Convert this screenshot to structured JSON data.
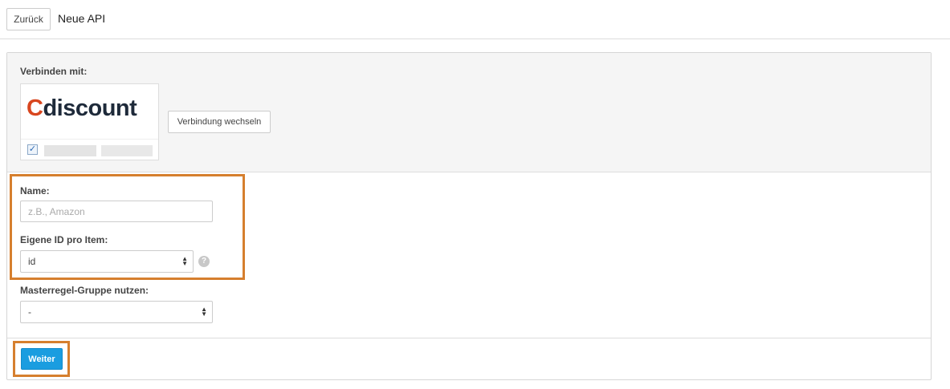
{
  "header": {
    "back_label": "Zurück",
    "title": "Neue API"
  },
  "connection": {
    "label": "Verbinden mit:",
    "logo_text_first": "C",
    "logo_text_rest": "discount",
    "checkbox_checked": true,
    "switch_label": "Verbindung wechseln"
  },
  "form": {
    "name_label": "Name:",
    "name_placeholder": "z.B., Amazon",
    "id_label": "Eigene ID pro Item:",
    "id_value": "id",
    "master_label": "Masterregel-Gruppe nutzen:",
    "master_value": "-"
  },
  "footer": {
    "submit_label": "Weiter"
  },
  "colors": {
    "accent": "#1a9de0",
    "highlight": "#d67f2e",
    "logo_accent": "#d8461f"
  },
  "icons": [
    "checkbox-icon",
    "select-caret-icon",
    "help-icon"
  ]
}
